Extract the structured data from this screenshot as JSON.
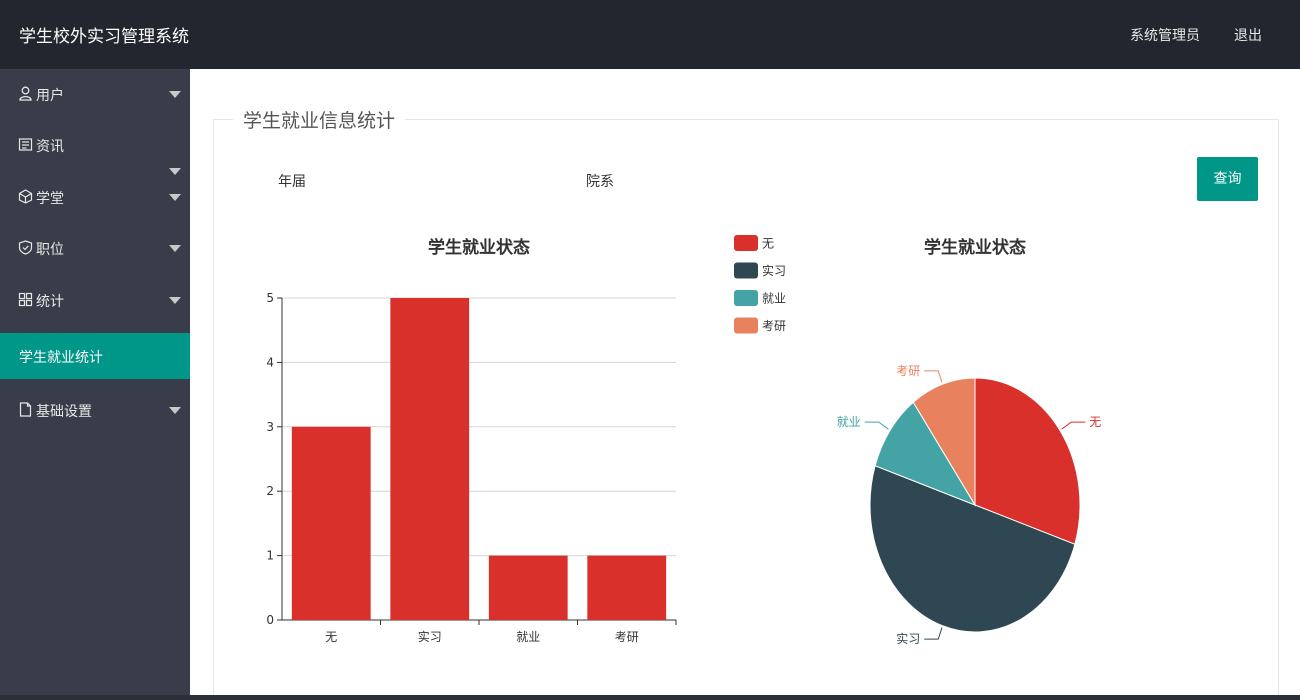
{
  "header": {
    "title": "学生校外实习管理系统",
    "user": "系统管理员",
    "logout": "退出"
  },
  "sidebar": {
    "items": [
      {
        "label": "用户",
        "icon": "user-icon",
        "has_arrow": true
      },
      {
        "label": "资讯",
        "icon": "news-icon",
        "has_arrow": false
      },
      {
        "label": "学堂",
        "icon": "cube-icon",
        "has_arrow": true
      },
      {
        "label": "职位",
        "icon": "shield-icon",
        "has_arrow": true
      },
      {
        "label": "统计",
        "icon": "grid-icon",
        "has_arrow": true
      },
      {
        "label": "学生就业统计",
        "icon": "",
        "has_arrow": false,
        "active": true
      },
      {
        "label": "基础设置",
        "icon": "file-icon",
        "has_arrow": true
      }
    ]
  },
  "main": {
    "section_title": "学生就业信息统计",
    "filters": {
      "year_label": "年届",
      "dept_label": "院系"
    },
    "query_button": "查询"
  },
  "colors": {
    "accent": "#009688",
    "sidebar": "#393d49",
    "topbar": "#23262e"
  },
  "chart_data": [
    {
      "type": "bar",
      "title": "学生就业状态",
      "categories": [
        "无",
        "实习",
        "就业",
        "考研"
      ],
      "values": [
        3,
        5,
        1,
        1
      ],
      "ylim": [
        0,
        5
      ],
      "yticks": [
        0,
        1,
        2,
        3,
        4,
        5
      ],
      "color": "#d9302c",
      "grid": true
    },
    {
      "type": "pie",
      "title": "学生就业状态",
      "slices": [
        {
          "label": "无",
          "value": 3,
          "color": "#d9302c"
        },
        {
          "label": "实习",
          "value": 5,
          "color": "#2f4752"
        },
        {
          "label": "就业",
          "value": 1,
          "color": "#44a3a5"
        },
        {
          "label": "考研",
          "value": 1,
          "color": "#e8825e"
        }
      ],
      "legend": "top-left"
    }
  ]
}
